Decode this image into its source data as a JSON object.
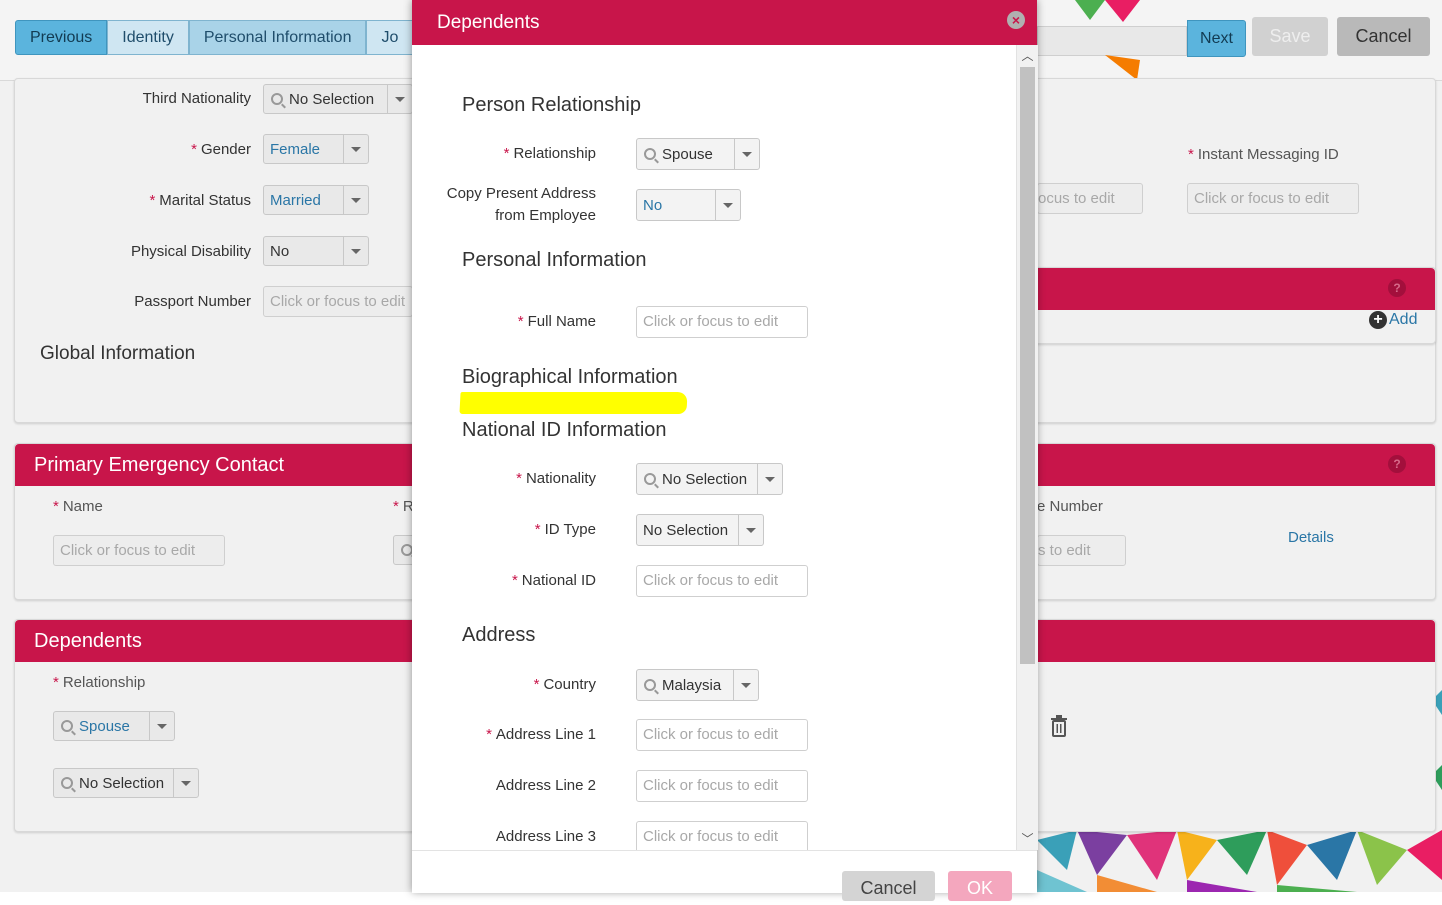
{
  "header": {
    "breadcrumbs": [
      "Previous",
      "Identity",
      "Personal Information",
      "Jo"
    ],
    "next_label": "Next",
    "save_label": "Save",
    "cancel_label": "Cancel"
  },
  "background": {
    "personal": {
      "third_nationality_label": "Third Nationality",
      "third_nationality_value": "No Selection",
      "gender_label": "Gender",
      "gender_value": "Female",
      "marital_status_label": "Marital Status",
      "marital_status_value": "Married",
      "physical_disability_label": "Physical Disability",
      "physical_disability_value": "No",
      "passport_label": "Passport Number",
      "passport_placeholder": "Click or focus to edit",
      "global_info_heading": "Global Information",
      "im_label": "Instant Messaging ID",
      "im_placeholder": "Click or focus to edit",
      "partial_field_placeholder": "ocus to edit"
    },
    "email_panel": {
      "add_label": "Add"
    },
    "emergency": {
      "title": "Primary Emergency Contact",
      "name_label": "Name",
      "name_placeholder": "Click or focus to edit",
      "partial_label": "R",
      "phone_label_partial": "e Number",
      "phone_placeholder_partial": "s to edit",
      "details_link": "Details"
    },
    "dependents_panel": {
      "title": "Dependents",
      "relationship_label": "Relationship",
      "relationship_value": "Spouse",
      "second_value": "No Selection"
    }
  },
  "modal": {
    "title": "Dependents",
    "sections": {
      "person_relationship": "Person Relationship",
      "personal_information": "Personal Information",
      "biographical_information": "Biographical Information",
      "national_id_information": "National ID Information",
      "address": "Address"
    },
    "fields": {
      "relationship_label": "Relationship",
      "relationship_value": "Spouse",
      "copy_address_label_1": "Copy Present Address",
      "copy_address_label_2": "from Employee",
      "copy_address_value": "No",
      "full_name_label": "Full Name",
      "nationality_label": "Nationality",
      "nationality_value": "No Selection",
      "id_type_label": "ID Type",
      "id_type_value": "No Selection",
      "national_id_label": "National ID",
      "country_label": "Country",
      "country_value": "Malaysia",
      "address1_label": "Address Line 1",
      "address2_label": "Address Line 2",
      "address3_label": "Address Line 3",
      "placeholder": "Click or focus to edit"
    },
    "footer": {
      "cancel_label": "Cancel",
      "ok_label": "OK"
    }
  },
  "colors": {
    "brand": "#c8154a",
    "link": "#2a76a6",
    "highlight": "#ffff00"
  }
}
